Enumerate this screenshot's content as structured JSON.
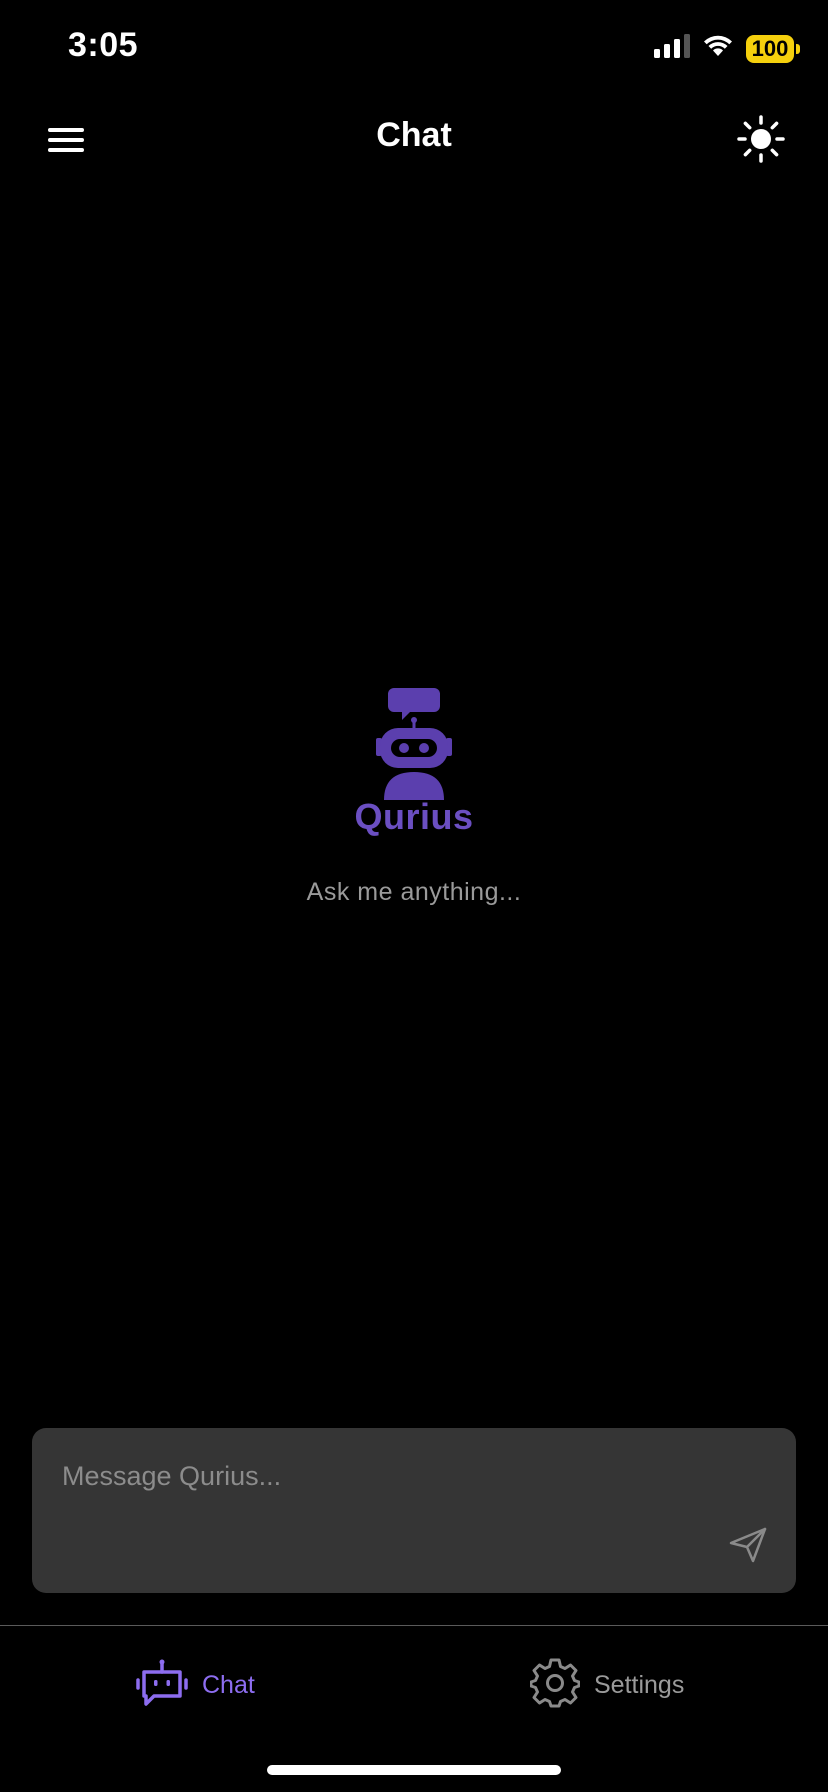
{
  "status_bar": {
    "time": "3:05",
    "battery_level": "100",
    "icons": [
      "signal-icon",
      "wifi-icon",
      "battery-icon"
    ]
  },
  "header": {
    "title": "Chat",
    "menu_icon": "hamburger-menu-icon",
    "theme_icon": "sun-icon"
  },
  "empty_state": {
    "brand": "Qurius",
    "tagline": "Ask me anything...",
    "logo_icon": "robot-chat-icon"
  },
  "composer": {
    "placeholder": "Message Qurius...",
    "value": "",
    "send_icon": "send-icon"
  },
  "tabs": [
    {
      "label": "Chat",
      "icon": "robot-icon",
      "active": true
    },
    {
      "label": "Settings",
      "icon": "gear-icon",
      "active": false
    }
  ],
  "colors": {
    "background": "#000000",
    "accent": "#6b4fc2",
    "accent_active_tab": "#8d6df0",
    "battery": "#f5d00d",
    "composer_bg": "#353535",
    "muted_text": "#9a9a9a"
  }
}
